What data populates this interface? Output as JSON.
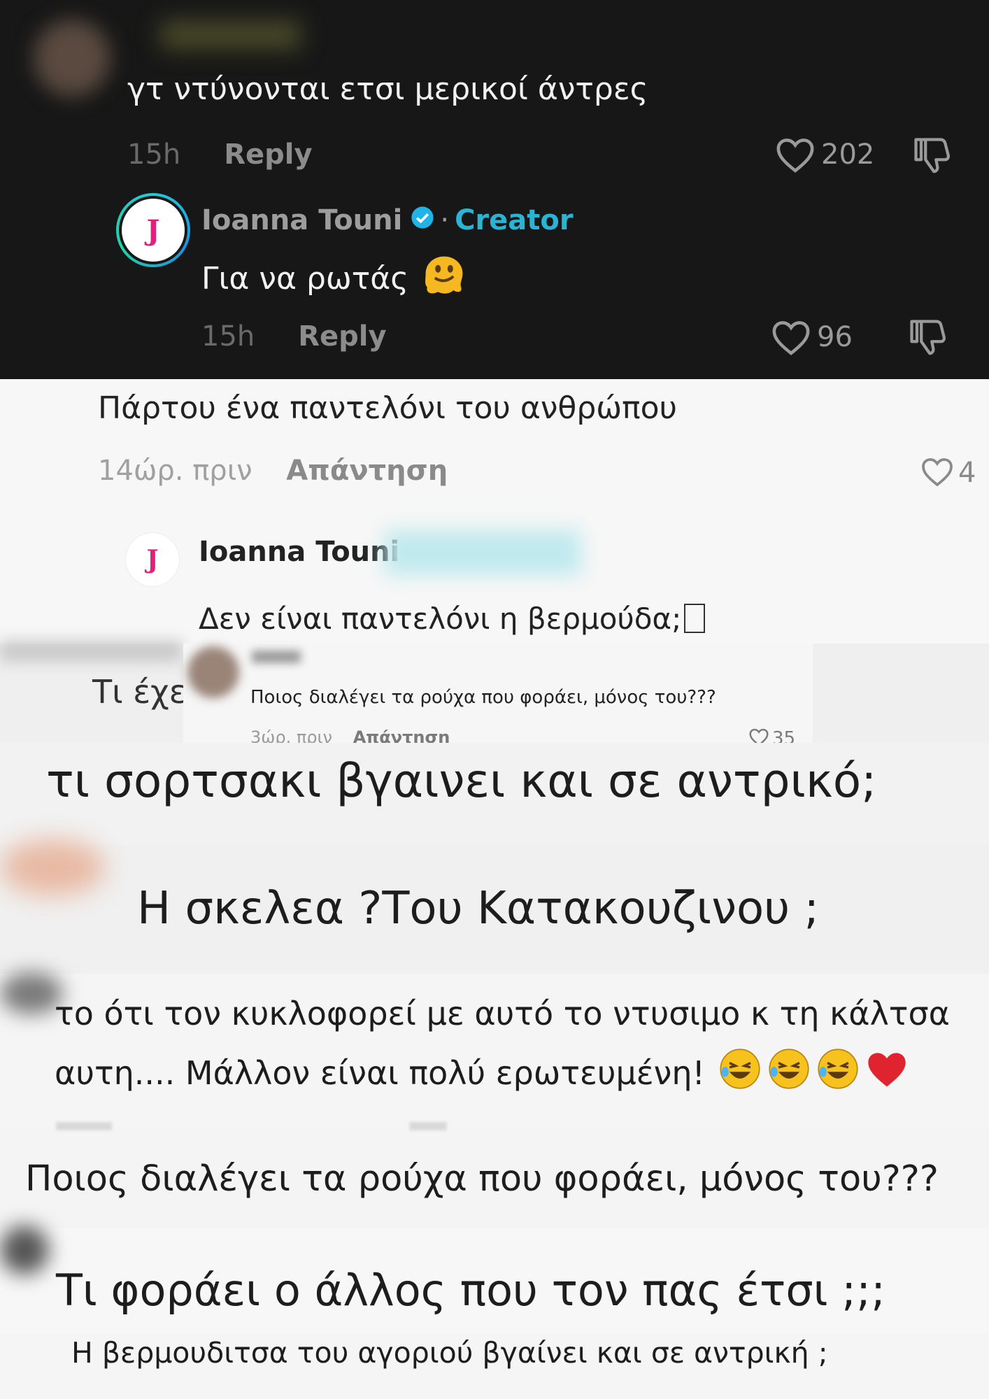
{
  "dark_panel": {
    "comment1": {
      "text": "γτ ντύνονται ετσι μερικοί άντρες",
      "time": "15h",
      "reply_label": "Reply",
      "likes": "202"
    },
    "reply1": {
      "avatar_letter": "J",
      "author": "Ioanna Touni",
      "separator": "·",
      "creator_tag": "Creator",
      "text": "Για να ρωτάς",
      "time": "15h",
      "reply_label": "Reply",
      "likes": "96"
    }
  },
  "light_panel": {
    "comment": {
      "text": "Πάρτου ένα παντελόνι του ανθρώπου",
      "time": "14ώρ. πριν",
      "reply_label": "Απάντηση",
      "likes": "4"
    },
    "reply": {
      "avatar_letter": "J",
      "author": "Ioanna Touni",
      "text": "Δεν είναι παντελόνι η βερμούδα;"
    },
    "partial_comment": "Τι έχε",
    "overlay_comment": {
      "text": "Ποιος διαλέγει τα ρούχα που φοράει, μόνος του???",
      "time": "3ώρ. πριν",
      "reply_label": "Απάντηση",
      "likes": "35"
    }
  },
  "strips": [
    {
      "text": "τι σορτσακι βγαινει και σε αντρικό;"
    },
    {
      "text": "Η σκελεα ?Του Κατακουζινου ;"
    },
    {
      "line1": "το ότι τον κυκλοφορεί με αυτό το ντυσιμο κ τη κάλτσα",
      "line2": "αυτη.... Μάλλον είναι πολύ ερωτευμένη!"
    },
    {
      "text": "Ποιος διαλέγει τα ρούχα που φοράει, μόνος του???"
    },
    {
      "text": "Τι φοράει ο άλλος που τον πας έτσι ;;;"
    },
    {
      "text": "Η βερμουδιτσα του αγοριού βγαίνει και σε αντρική ;"
    }
  ],
  "colors": {
    "dark_bg": "#171717",
    "light_bg": "#f4f4f4",
    "creator_blue": "#2ab4d4",
    "avatar_pink": "#e0207a"
  },
  "icons": [
    "heart-icon",
    "dislike-icon",
    "verified-badge-icon",
    "melting-face-emoji",
    "laughing-emoji",
    "red-heart-emoji"
  ]
}
